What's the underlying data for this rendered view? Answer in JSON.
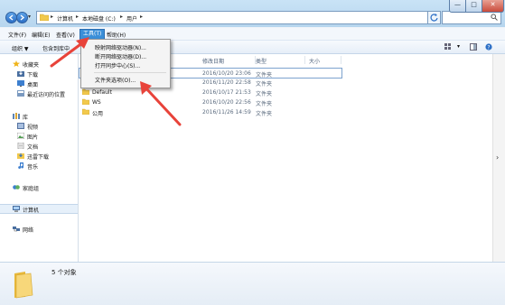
{
  "address": {
    "crumbs": [
      "计算机",
      "本地磁盘 (C:)",
      "用户"
    ]
  },
  "window_buttons": {
    "min": "—",
    "max": "□",
    "close": "✕"
  },
  "menubar": {
    "items": [
      "文件(F)",
      "编辑(E)",
      "查看(V)",
      "工具(T)",
      "帮助(H)"
    ],
    "active_index": 3
  },
  "toolbar": {
    "organize": "组织 ▼",
    "include": "包含到库中"
  },
  "tools_menu": {
    "items": [
      "映射网络驱动器(N)...",
      "断开网络驱动器(D)...",
      "打开同步中心(S)...",
      "文件夹选项(O)..."
    ]
  },
  "columns": {
    "date": "修改日期",
    "type": "类型",
    "size": "大小"
  },
  "files": [
    {
      "name": "",
      "date": "2016/10/20 23:06",
      "type": "文件夹"
    },
    {
      "name": "",
      "date": "2016/11/20 22:58",
      "type": "文件夹"
    },
    {
      "name": "Default",
      "date": "2016/10/17 21:53",
      "type": "文件夹"
    },
    {
      "name": "WS",
      "date": "2016/10/20 22:56",
      "type": "文件夹"
    },
    {
      "name": "公用",
      "date": "2016/11/26 14:59",
      "type": "文件夹"
    }
  ],
  "nav": {
    "favorites": "收藏夹",
    "downloads": "下载",
    "desktop": "桌面",
    "recent": "最近访问的位置",
    "libraries": "库",
    "videos": "视频",
    "pictures": "图片",
    "documents": "文档",
    "thunder": "迅雷下载",
    "music": "音乐",
    "homegroup": "家庭组",
    "computer": "计算机",
    "network": "网络"
  },
  "status": {
    "count_text": "5 个对象"
  },
  "colors": {
    "accent": "#3b8fd8",
    "arrow": "#e8433a",
    "folder": "#f2c94c"
  }
}
